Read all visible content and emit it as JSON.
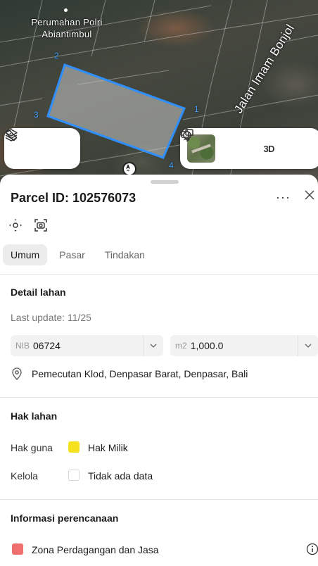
{
  "map": {
    "place_label_line1": "Perumahan Polri",
    "place_label_line2": "Abiantimbul",
    "road_label": "Jalan Imam Bonjol",
    "vertex_labels": [
      "1",
      "2",
      "3",
      "4"
    ],
    "view_3d_label": "3D"
  },
  "colors": {
    "parcel_outline": "#2f8fff",
    "hak_milik": "#f5e11d",
    "zona": "#f07070"
  },
  "icons": {
    "layers": "layers-icon",
    "measure": "ruler-icon",
    "locate": "crosshair-icon",
    "compare": "compare-icon",
    "compass": "compass-icon",
    "location": "location-pin-icon",
    "info": "info-icon"
  },
  "header": {
    "title": "Parcel ID: 102576073",
    "more": "···"
  },
  "tabs": [
    {
      "label": "Umum",
      "active": true
    },
    {
      "label": "Pasar",
      "active": false
    },
    {
      "label": "Tindakan",
      "active": false
    }
  ],
  "detail": {
    "title": "Detail lahan",
    "last_update": "Last update: 11/25",
    "nib_prefix": "NIB",
    "nib_value": "06724",
    "area_prefix": "m2",
    "area_value": "1,000.0",
    "address": "Pemecutan Klod, Denpasar Barat, Denpasar, Bali"
  },
  "hak": {
    "title": "Hak lahan",
    "guna_label": "Hak guna",
    "guna_value": "Hak Milik",
    "kelola_label": "Kelola",
    "kelola_value": "Tidak ada data"
  },
  "planning": {
    "title": "Informasi perencanaan",
    "zona_value": "Zona Perdagangan dan Jasa"
  }
}
